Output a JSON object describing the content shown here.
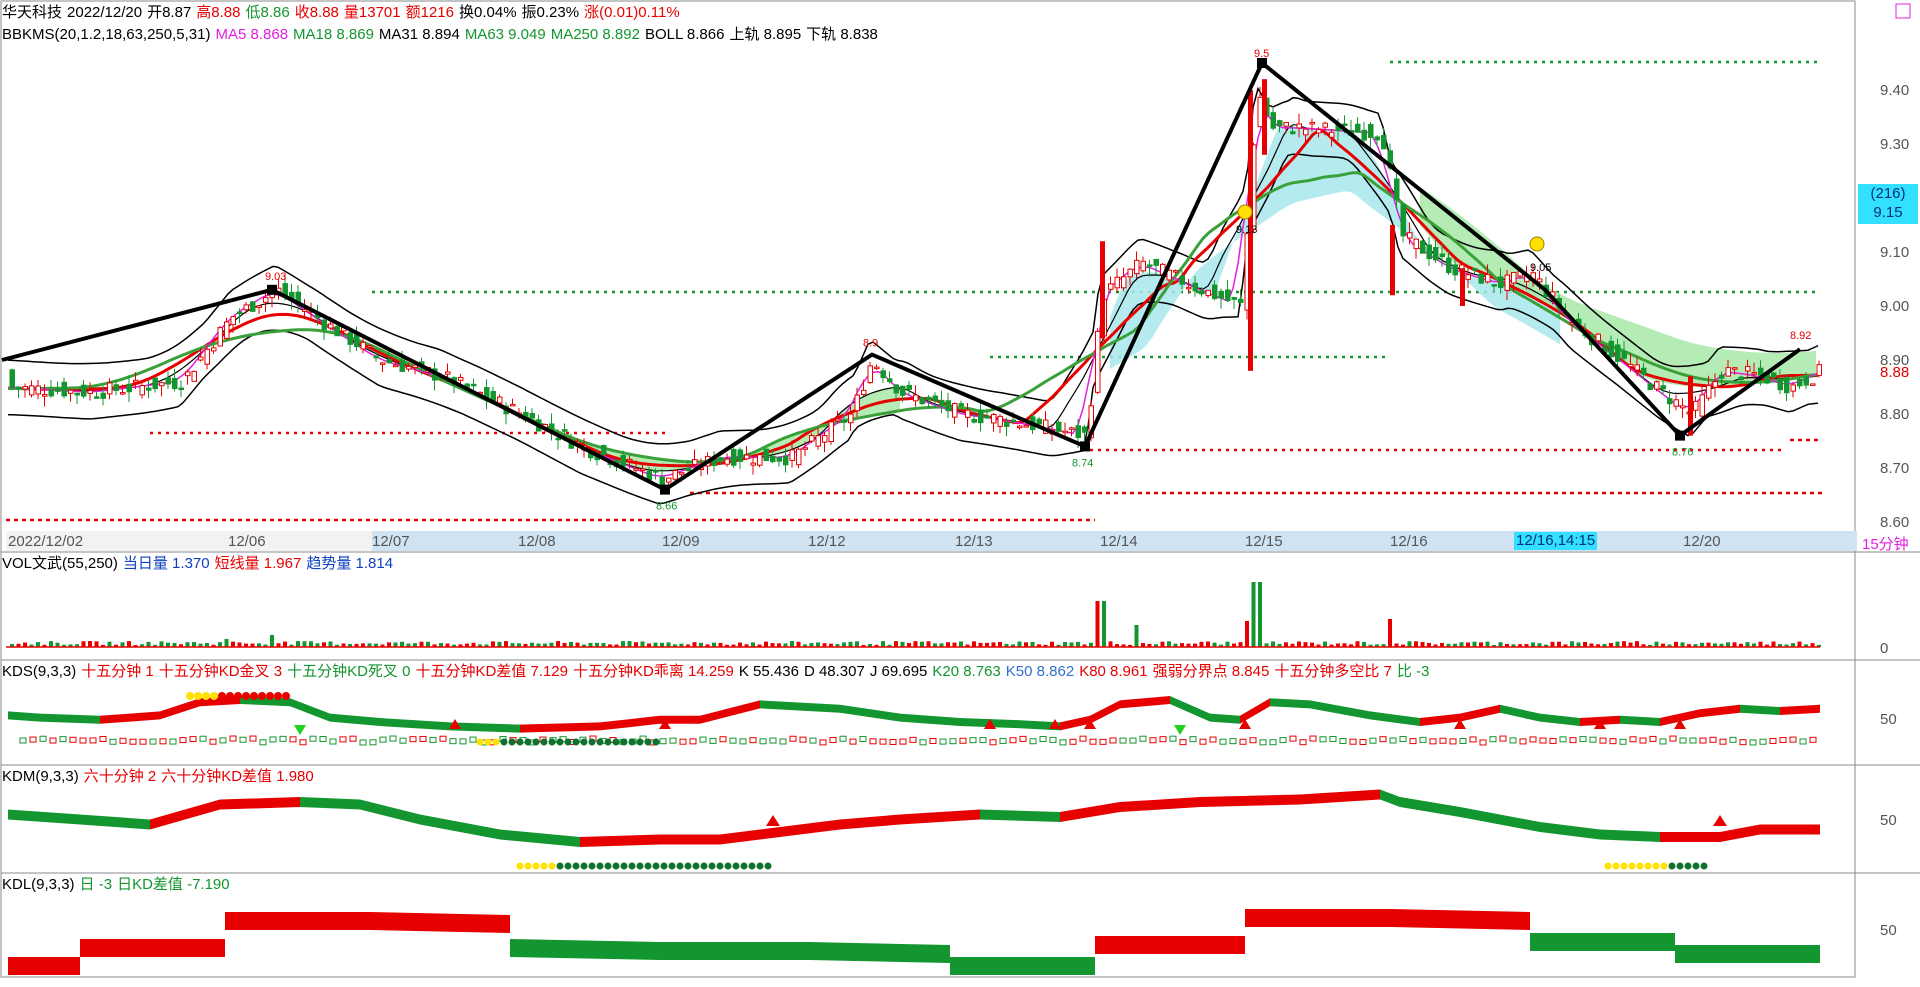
{
  "header": {
    "stock_name": "华天科技",
    "date": "2022/12/20",
    "open": "开8.87",
    "high": "高8.88",
    "low": "低8.86",
    "close": "收8.88",
    "volume": "量13701",
    "amount": "额1216",
    "turnover": "换0.04%",
    "amplitude": "振0.23%",
    "change": "涨(0.01)0.11%"
  },
  "main_indicator": {
    "name": "BBKMS(20,1.2,18,63,250,5,31)",
    "ma5": "MA5 8.868",
    "ma18": "MA18 8.869",
    "ma31": "MA31 8.894",
    "ma63": "MA63 9.049",
    "ma250": "MA250 8.892",
    "boll": "BOLL 8.866",
    "upper": "上轨 8.895",
    "lower": "下轨 8.838"
  },
  "right_box": {
    "count": "(216)",
    "price": "9.15"
  },
  "current_price": "8.88",
  "period_label": "15分钟",
  "highlight_date": "12/16,14:15",
  "dates": [
    "2022/12/02",
    "12/06",
    "12/07",
    "12/08",
    "12/09",
    "12/12",
    "12/13",
    "12/14",
    "12/15",
    "12/16",
    "12/20"
  ],
  "price_axis": [
    "9.40",
    "9.30",
    "9.10",
    "9.00",
    "8.90",
    "8.80",
    "8.70",
    "8.60"
  ],
  "annotations": {
    "p1": "9.03",
    "p2": "8.66",
    "p3": "8.9",
    "p4": "8.74",
    "p5": "9.5",
    "p6": "9.13",
    "p7": "9.05",
    "p8": "8.92",
    "p9": "8.76"
  },
  "vol_panel": {
    "name": "VOL文武(55,250)",
    "daily": "当日量 1.370",
    "short": "短线量 1.967",
    "trend": "趋势量 1.814",
    "axis_zero": "0"
  },
  "kds_panel": {
    "name": "KDS(9,3,3)",
    "v1": "十五分钟 1",
    "v2": "十五分钟KD金叉 3",
    "v3": "十五分钟KD死叉 0",
    "v4": "十五分钟KD差值 7.129",
    "v5": "十五分钟KD乖离 14.259",
    "k": "K 55.436",
    "d": "D 48.307",
    "j": "J 69.695",
    "k20": "K20 8.763",
    "k50": "K50 8.862",
    "k80": "K80 8.961",
    "strong": "强弱分界点 8.845",
    "ratio": "十五分钟多空比 7",
    "bi": "比 -3",
    "axis": "50"
  },
  "kdm_panel": {
    "name": "KDM(9,3,3)",
    "v1": "六十分钟 2",
    "v2": "六十分钟KD差值 1.980",
    "axis": "50"
  },
  "kdl_panel": {
    "name": "KDL(9,3,3)",
    "v1": "日 -3",
    "v2": "日KD差值 -7.190",
    "axis": "50"
  },
  "colors": {
    "up": "#e60000",
    "down": "#13962f",
    "cyan": "#33e0ff",
    "bg": "#ffffff"
  }
}
